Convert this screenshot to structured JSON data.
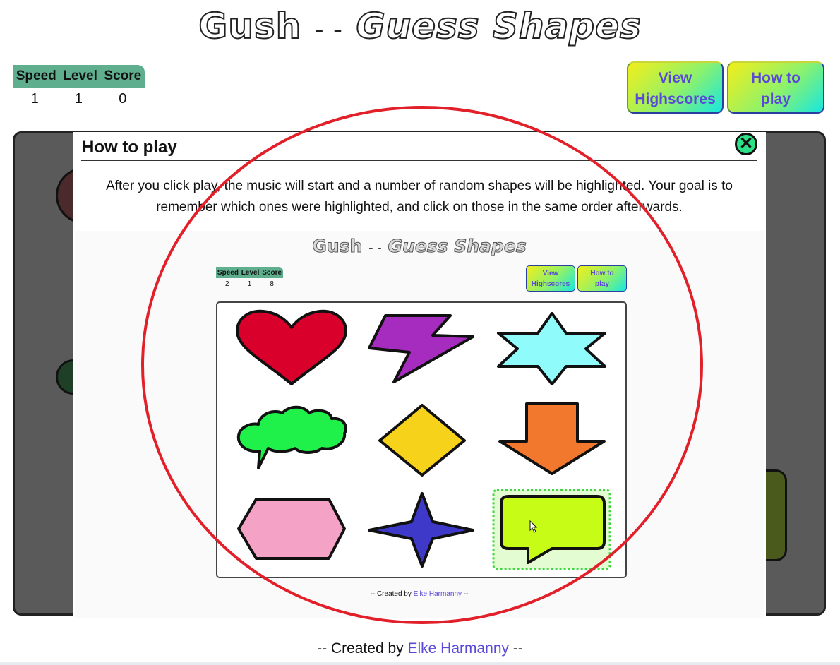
{
  "app": {
    "title_part1": "Gush",
    "title_sep": "- -",
    "title_part2": "Guess Shapes"
  },
  "stats": {
    "labels": [
      "Speed",
      "Level",
      "Score"
    ],
    "values": [
      "1",
      "1",
      "0"
    ]
  },
  "buttons": {
    "highscores_line1": "View",
    "highscores_line2": "Highscores",
    "howto_line1": "How to",
    "howto_line2": "play"
  },
  "modal": {
    "title": "How to play",
    "close_icon": "close-x-icon",
    "text": "After you click play, the music will start and a number of random shapes will be highlighted. Your goal is to remember which ones were highlighted, and click on those in the same order afterwards."
  },
  "preview": {
    "title_part1": "Gush",
    "title_sep": "- -",
    "title_part2": "Guess Shapes",
    "stats_labels": [
      "Speed",
      "Level",
      "Score"
    ],
    "stats_values": [
      "2",
      "1",
      "8"
    ],
    "highscores_line1": "View",
    "highscores_line2": "Highscores",
    "howto_line1": "How to",
    "howto_line2": "play",
    "shapes": [
      {
        "name": "heart",
        "color": "#d9002b"
      },
      {
        "name": "lightning",
        "color": "#a62bbf"
      },
      {
        "name": "six-point-star",
        "color": "#8ffcfb"
      },
      {
        "name": "cloud-bubble",
        "color": "#1ff04a"
      },
      {
        "name": "diamond",
        "color": "#f6d21b"
      },
      {
        "name": "down-arrow",
        "color": "#f1782c"
      },
      {
        "name": "hexagon",
        "color": "#f4a3c6"
      },
      {
        "name": "four-point-star",
        "color": "#3e39c8"
      },
      {
        "name": "speech-bubble",
        "color": "#c7fc17",
        "highlighted": true
      }
    ],
    "footer_prefix": "-- Created by",
    "footer_author": "Elke Harmanny",
    "footer_suffix": "--"
  },
  "footer": {
    "prefix": "-- Created by",
    "author": "Elke Harmanny",
    "suffix": "--"
  },
  "annotation": {
    "color": "#e2202a"
  }
}
